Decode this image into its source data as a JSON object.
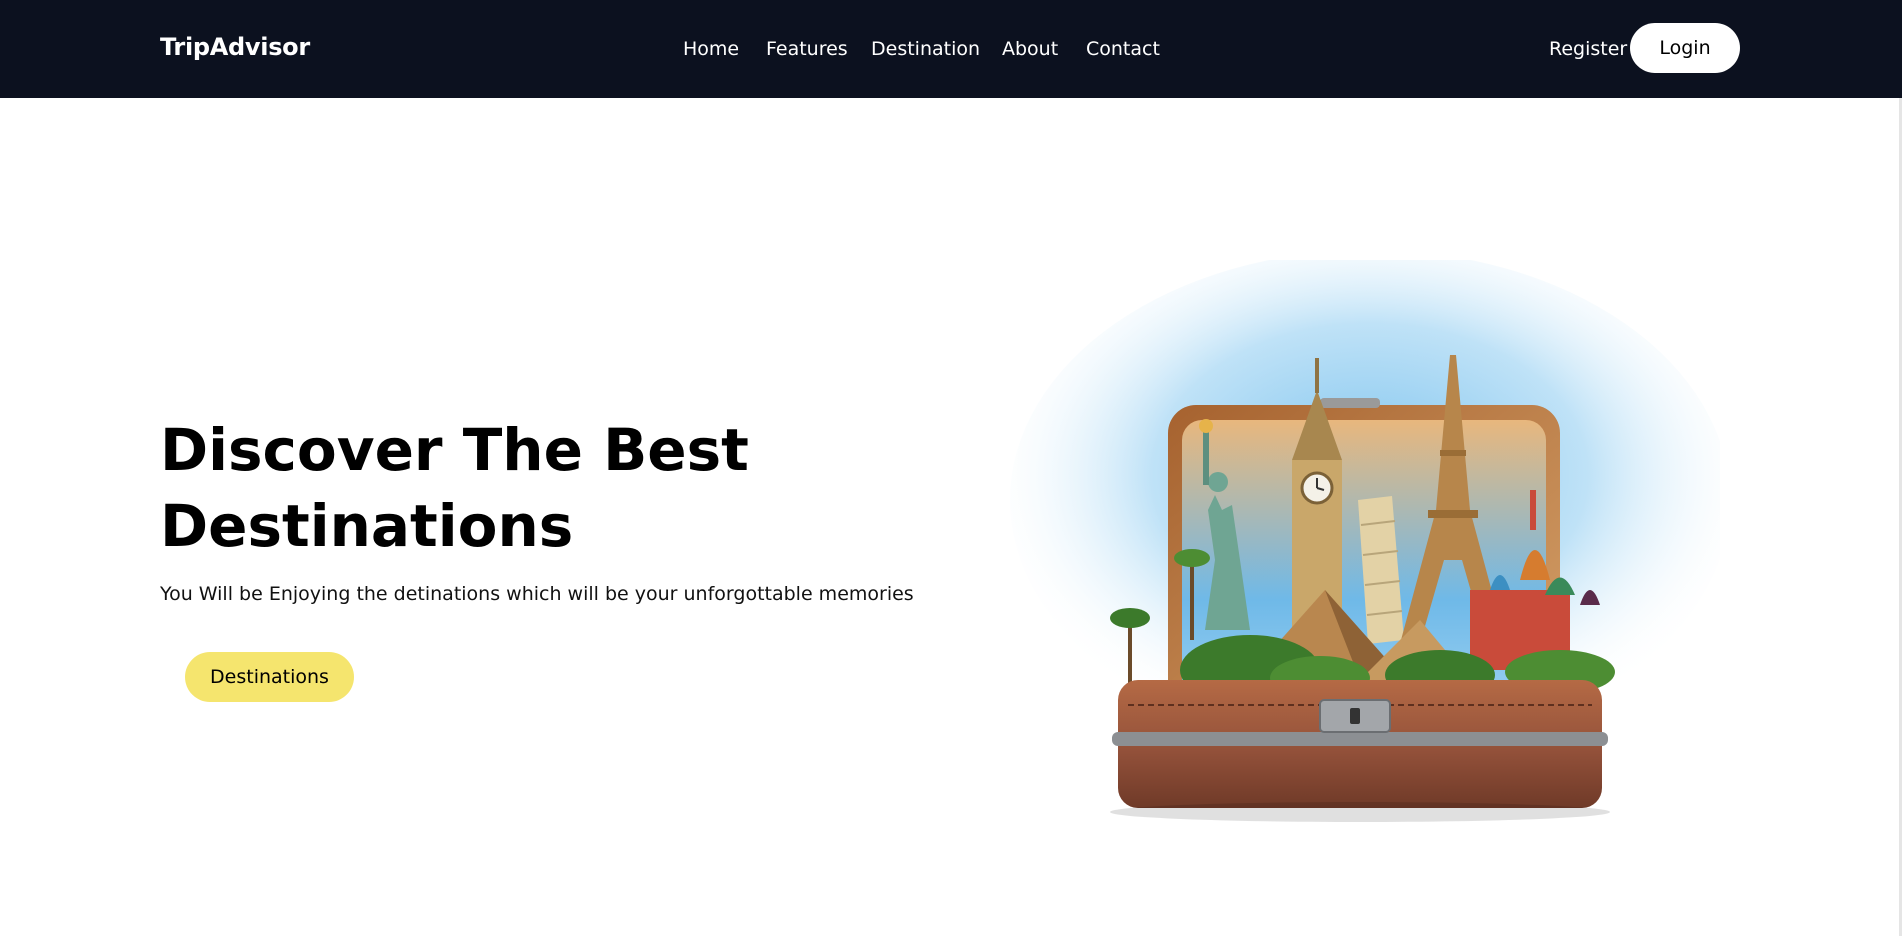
{
  "nav": {
    "brand": "TripAdvisor",
    "links": [
      "Home",
      "Features",
      "Destination",
      "About",
      "Contact"
    ],
    "register": "Register",
    "login": "Login"
  },
  "hero": {
    "title_line1": "Discover The Best",
    "title_line2": "Destinations",
    "subtitle": "You Will be Enjoying the detinations which will be your unforgottable memories",
    "cta": "Destinations",
    "image_icon": "suitcase-with-world-landmarks"
  },
  "colors": {
    "navbar_bg": "#0c111f",
    "cta_bg": "#f5e56e",
    "login_bg": "#ffffff"
  }
}
